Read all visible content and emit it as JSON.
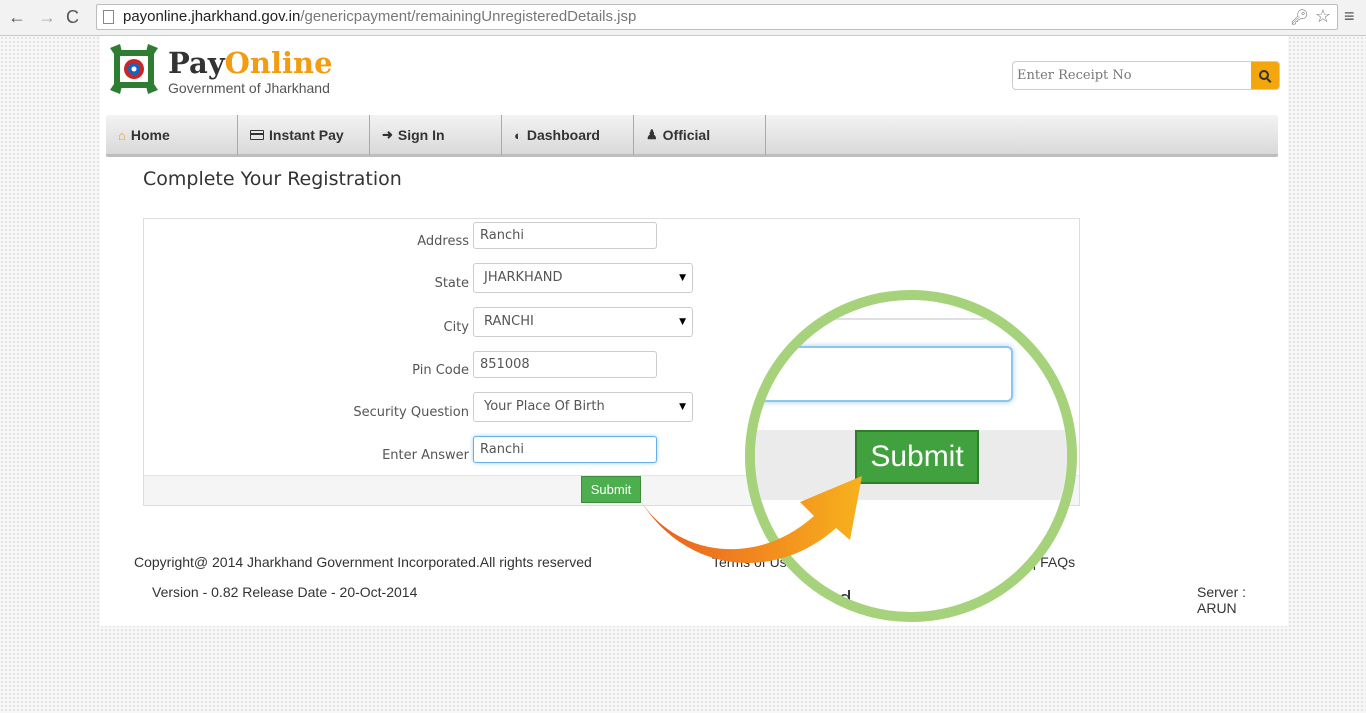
{
  "browser": {
    "url_domain": "payonline.jharkhand.gov.in",
    "url_path": "/genericpayment/remainingUnregisteredDetails.jsp",
    "back": "←",
    "forward": "→",
    "reload": "C",
    "key": "🔑︎",
    "star": "☆",
    "menu": "≡"
  },
  "header": {
    "brand_pay": "Pay",
    "brand_online": "Online",
    "brand_sub": "Government of Jharkhand",
    "receipt_placeholder": "Enter Receipt No"
  },
  "nav": {
    "items": [
      {
        "label": "Home",
        "icon": "home-icon"
      },
      {
        "label": "Instant Pay",
        "icon": "credit-card-icon"
      },
      {
        "label": "Sign In",
        "icon": "sign-in-icon"
      },
      {
        "label": "Dashboard",
        "icon": "dashboard-icon"
      },
      {
        "label": "Official",
        "icon": "user-icon"
      }
    ]
  },
  "form": {
    "title": "Complete Your Registration",
    "address_label": "Address",
    "address_value": "Ranchi",
    "state_label": "State",
    "state_value": "JHARKHAND",
    "city_label": "City",
    "city_value": "RANCHI",
    "pin_label": "Pin Code",
    "pin_value": "851008",
    "question_label": "Security Question",
    "question_value": "Your Place Of Birth",
    "answer_label": "Enter Answer",
    "answer_value": "Ranchi",
    "submit_label": "Submit"
  },
  "footer": {
    "copyright": "Copyright@ 2014 Jharkhand Government Incorporated.All rights reserved",
    "links": "Terms of Use | Privacy Policy | Feedback | Sitemap | FAQs",
    "version": "Version - 0.82 Release Date - 20-Oct-2014",
    "server": "Server : ARUN"
  },
  "callout": {
    "submit_label": "Submit",
    "fragment": "od"
  },
  "colors": {
    "accent": "#f39c12",
    "submit_green": "#4cae4c",
    "callout_ring": "#a6d27c",
    "arrow_orange": "#f07a1e"
  }
}
